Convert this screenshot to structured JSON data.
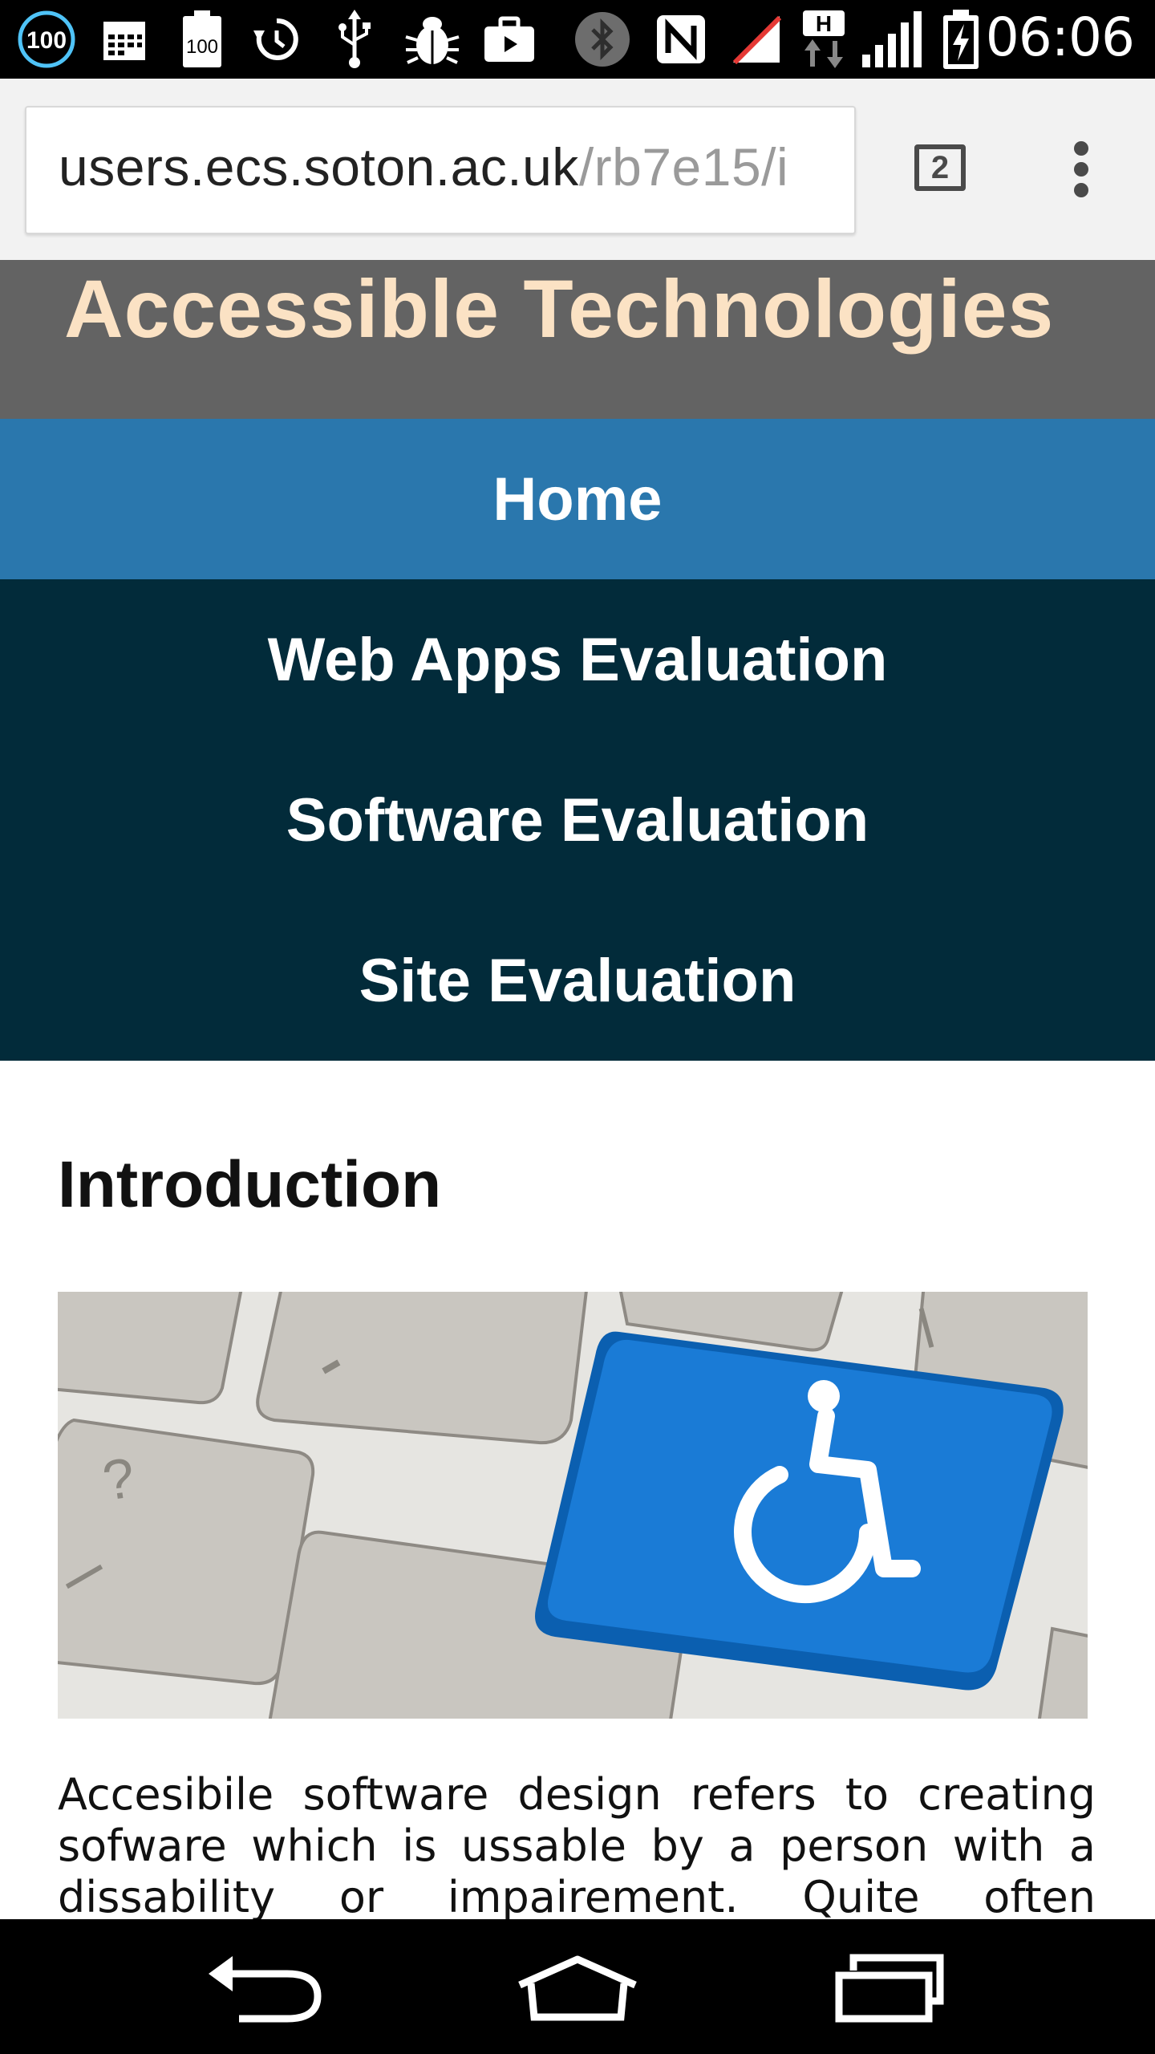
{
  "status_bar": {
    "battery_badge": "100",
    "battery_saver_badge": "100",
    "time": "06:06",
    "icons": [
      "battery-100-icon",
      "calendar-icon",
      "battery-saver-icon",
      "sync-icon",
      "usb-icon",
      "debug-bug-icon",
      "briefcase-icon",
      "bluetooth-icon",
      "nfc-icon",
      "no-signal-icon",
      "h-data-icon",
      "signal-bars-icon",
      "battery-charging-icon"
    ]
  },
  "browser": {
    "url_domain": "users.ecs.soton.ac.uk",
    "url_path": "/rb7e15/i",
    "tab_count": "2"
  },
  "site": {
    "title": "Accessible Technologies",
    "nav": [
      {
        "label": "Home",
        "active": true
      },
      {
        "label": "Web Apps Evaluation",
        "active": false
      },
      {
        "label": "Software Evaluation",
        "active": false
      },
      {
        "label": "Site Evaluation",
        "active": false
      }
    ],
    "intro_heading": "Introduction",
    "intro_text": "Accesibile software design refers to creating sofware which is ussable by a person with a dissability or impairement. Quite often accesing"
  },
  "colors": {
    "header_bg": "#636363",
    "title_color": "#fbe2c4",
    "nav_active_bg": "#2a77ad",
    "nav_bg": "#022b3a",
    "key_blue": "#1a7bd6"
  },
  "android_nav": [
    "back-icon",
    "home-icon",
    "recent-apps-icon"
  ]
}
